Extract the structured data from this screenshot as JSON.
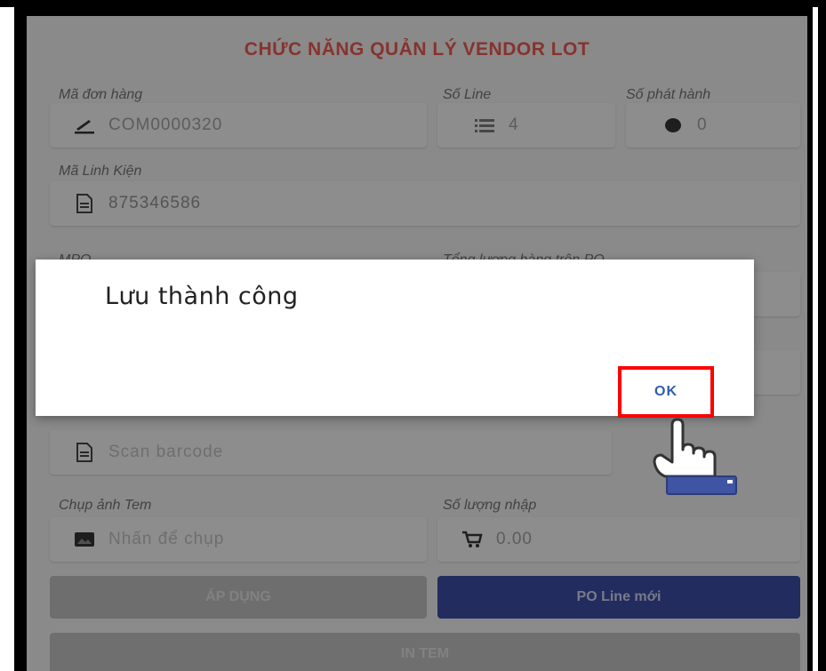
{
  "header": {
    "title": "CHỨC NĂNG QUẢN LÝ VENDOR LOT"
  },
  "fields": {
    "order_code": {
      "label": "Mã đơn hàng",
      "value": "COM0000320",
      "icon": "pencil-icon"
    },
    "line_no": {
      "label": "Số Line",
      "value": "4",
      "icon": "list-icon"
    },
    "release_no": {
      "label": "Số phát hành",
      "value": "0",
      "icon": "dot-icon"
    },
    "part_code": {
      "label": "Mã Linh Kiện",
      "value": "875346586",
      "icon": "document-icon"
    },
    "mpq": {
      "label": "MPQ"
    },
    "po_total": {
      "label": "Tổng lượng hàng trên PO"
    },
    "barcode": {
      "placeholder": "Scan barcode",
      "icon": "document-icon"
    },
    "photo": {
      "label": "Chụp ảnh Tem",
      "placeholder": "Nhấn để chụp",
      "icon": "image-icon"
    },
    "qty_input": {
      "label": "Số lượng nhập",
      "value": "0.00",
      "icon": "cart-icon"
    }
  },
  "buttons": {
    "apply": "ÁP DỤNG",
    "new_po_line": "PO Line mới",
    "print_label": "IN TEM"
  },
  "dialog": {
    "message": "Lưu thành công",
    "ok_label": "OK"
  },
  "colors": {
    "title_red": "#e2554e",
    "primary_blue": "#3a4a9e",
    "highlight_red": "#ff0000",
    "ok_blue": "#2f5fa8"
  }
}
